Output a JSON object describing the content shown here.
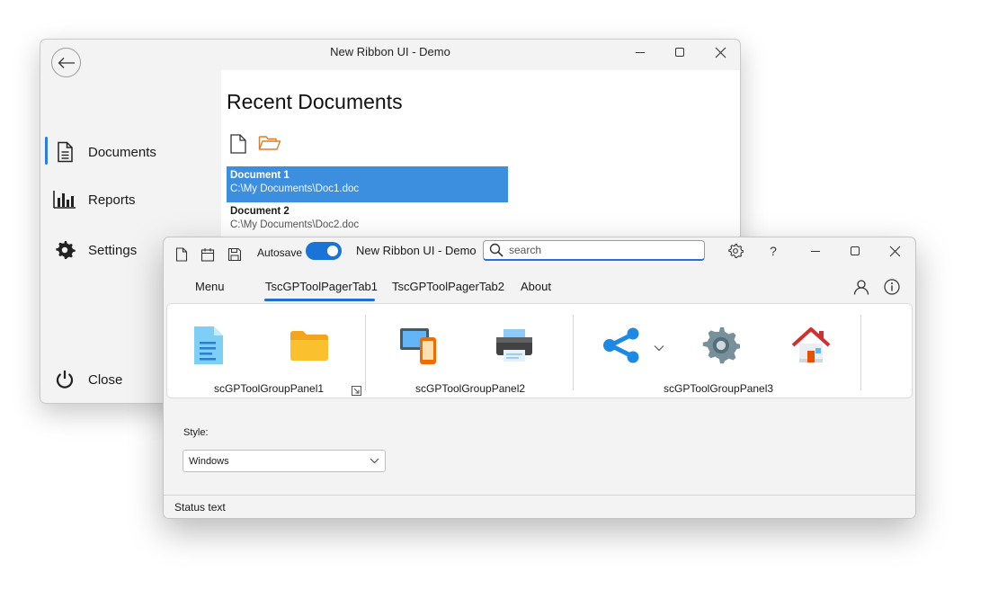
{
  "back_window": {
    "title": "New Ribbon UI - Demo",
    "nav": [
      {
        "label": "Documents",
        "icon": "document-icon"
      },
      {
        "label": "Reports",
        "icon": "bar-chart-icon"
      },
      {
        "label": "Settings",
        "icon": "gear-icon"
      },
      {
        "label": "Close",
        "icon": "power-icon"
      }
    ],
    "content_title": "Recent Documents",
    "documents": [
      {
        "name": "Document 1",
        "path": "C:\\My Documents\\Doc1.doc",
        "selected": true
      },
      {
        "name": "Document 2",
        "path": "C:\\My Documents\\Doc2.doc",
        "selected": false
      }
    ]
  },
  "front_window": {
    "title": "New Ribbon UI - Demo",
    "autosave_label": "Autosave",
    "autosave_on": true,
    "search_placeholder": "search",
    "tabs": [
      {
        "label": "Menu"
      },
      {
        "label": "TscGPToolPagerTab1",
        "active": true
      },
      {
        "label": "TscGPToolPagerTab2"
      },
      {
        "label": "About"
      }
    ],
    "panels": [
      {
        "label": "scGPToolGroupPanel1"
      },
      {
        "label": "scGPToolGroupPanel2"
      },
      {
        "label": "scGPToolGroupPanel3"
      }
    ],
    "style_label": "Style:",
    "style_value": "Windows",
    "status_text": "Status text"
  },
  "colors": {
    "accent": "#1e6fd0",
    "selection": "#3c8fdf"
  }
}
